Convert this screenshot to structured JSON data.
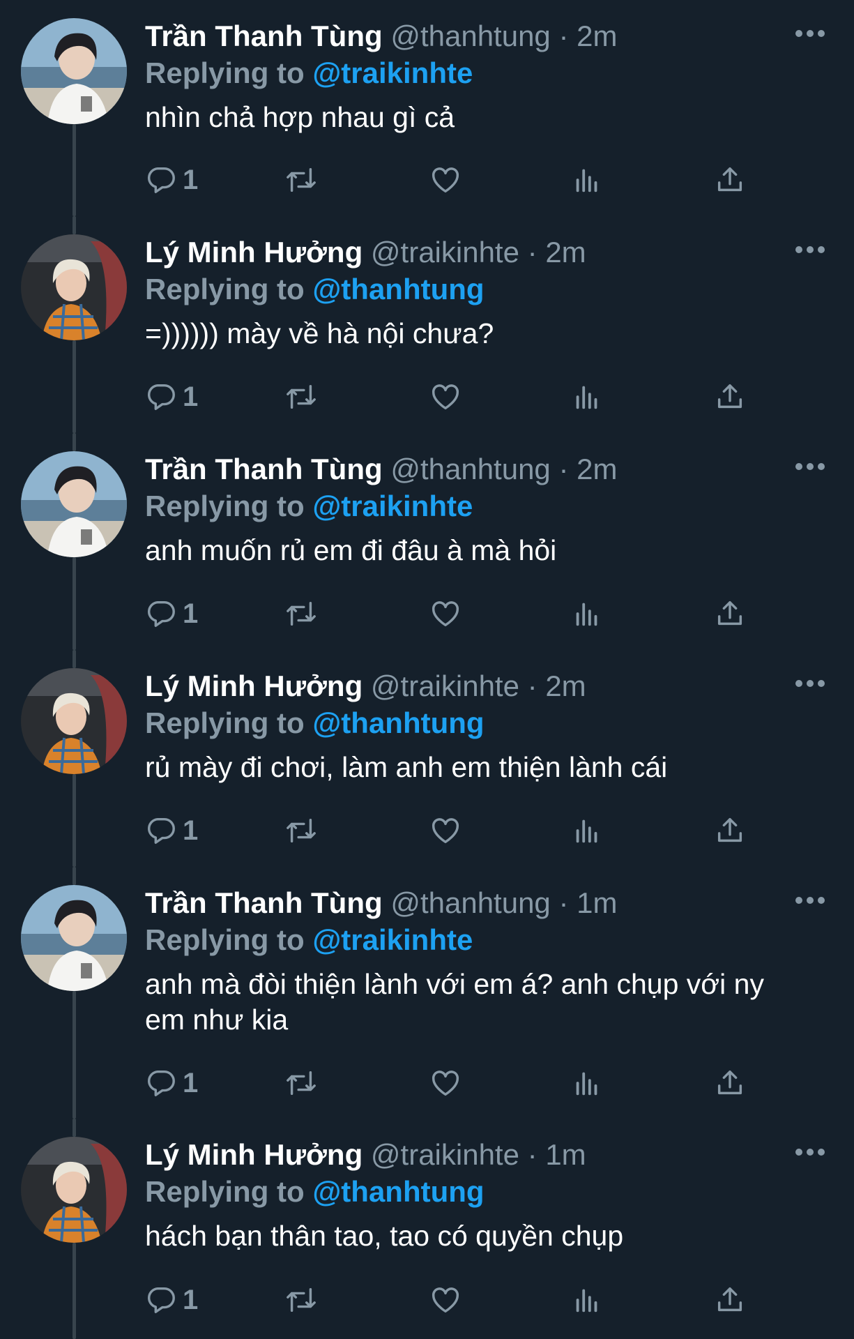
{
  "theme": {
    "background": "#15202b",
    "text": "#ffffff",
    "muted": "#8899a6",
    "link": "#1da1f2",
    "thread_line": "#38444d"
  },
  "tweets": [
    {
      "name": "Trần Thanh Tùng",
      "handle": "@thanhtung",
      "separator": "·",
      "time": "2m",
      "reply_label": "Replying to",
      "reply_to": "@traikinhte",
      "text": "nhìn chả hợp nhau gì cả",
      "reply_count": "1",
      "avatar": "avatar-thanhtung",
      "icons": [
        "reply-icon",
        "retweet-icon",
        "like-icon",
        "analytics-icon",
        "share-icon",
        "more-icon"
      ]
    },
    {
      "name": "Lý Minh Hưởng",
      "handle": "@traikinhte",
      "separator": "·",
      "time": "2m",
      "reply_label": "Replying to",
      "reply_to": "@thanhtung",
      "text": "=)))))) mày về hà nội chưa?",
      "reply_count": "1",
      "avatar": "avatar-traikinhte"
    },
    {
      "name": "Trần Thanh Tùng",
      "handle": "@thanhtung",
      "separator": "·",
      "time": "2m",
      "reply_label": "Replying to",
      "reply_to": "@traikinhte",
      "text": "anh muốn rủ em đi đâu à mà hỏi",
      "reply_count": "1",
      "avatar": "avatar-thanhtung"
    },
    {
      "name": "Lý Minh Hưởng",
      "handle": "@traikinhte",
      "separator": "·",
      "time": "2m",
      "reply_label": "Replying to",
      "reply_to": "@thanhtung",
      "text": "rủ mày đi chơi, làm anh em thiện lành cái",
      "reply_count": "1",
      "avatar": "avatar-traikinhte"
    },
    {
      "name": "Trần Thanh Tùng",
      "handle": "@thanhtung",
      "separator": "·",
      "time": "1m",
      "reply_label": "Replying to",
      "reply_to": "@traikinhte",
      "text": "anh mà đòi thiện lành với em á? anh chụp với ny em như kia",
      "reply_count": "1",
      "avatar": "avatar-thanhtung"
    },
    {
      "name": "Lý Minh Hưởng",
      "handle": "@traikinhte",
      "separator": "·",
      "time": "1m",
      "reply_label": "Replying to",
      "reply_to": "@thanhtung",
      "text": "hách bạn thân tao, tao có quyền chụp",
      "reply_count": "1",
      "avatar": "avatar-traikinhte"
    }
  ]
}
